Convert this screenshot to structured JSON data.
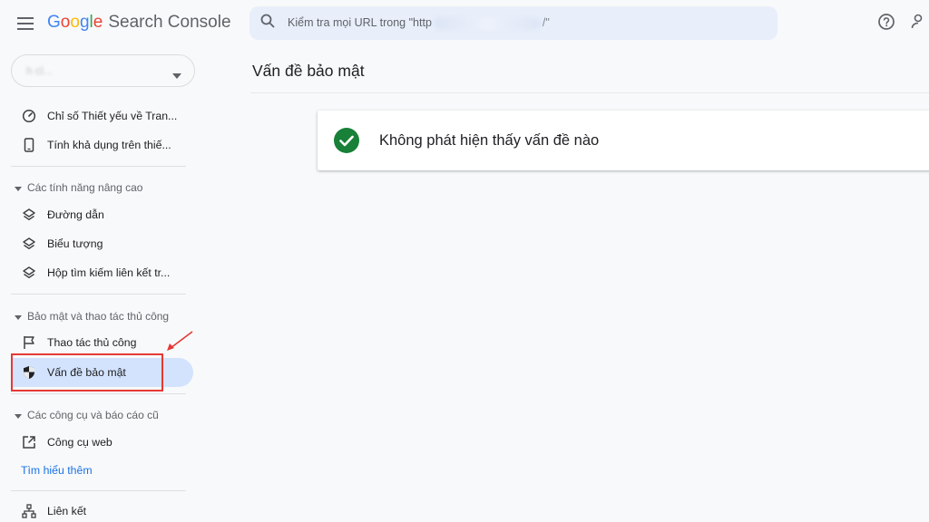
{
  "app": {
    "logo_letters": [
      {
        "char": "G",
        "color": "#4285f4"
      },
      {
        "char": "o",
        "color": "#ea4335"
      },
      {
        "char": "o",
        "color": "#fbbc05"
      },
      {
        "char": "g",
        "color": "#4285f4"
      },
      {
        "char": "l",
        "color": "#34a853"
      },
      {
        "char": "e",
        "color": "#ea4335"
      }
    ],
    "product_name": "Search Console"
  },
  "search": {
    "placeholder_prefix": "Kiểm tra mọi URL trong \"http",
    "placeholder_suffix": "/\""
  },
  "property": {
    "name": "h                cl..."
  },
  "sidebar": {
    "items_top": [
      {
        "label": "Chỉ số Thiết yếu về Tran...",
        "icon": "gauge-icon"
      },
      {
        "label": "Tính khả dụng trên thiế...",
        "icon": "smartphone-icon"
      }
    ],
    "sections": [
      {
        "label": "Các tính năng nâng cao",
        "items": [
          {
            "label": "Đường dẫn",
            "icon": "layers-icon"
          },
          {
            "label": "Biểu tượng",
            "icon": "layers-icon"
          },
          {
            "label": "Hộp tìm kiếm liên kết tr...",
            "icon": "layers-icon"
          }
        ]
      },
      {
        "label": "Bảo mật và thao tác thủ công",
        "items": [
          {
            "label": "Thao tác thủ công",
            "icon": "flag-icon"
          },
          {
            "label": "Vấn đề bảo mật",
            "icon": "shield-icon",
            "active": true
          }
        ]
      },
      {
        "label": "Các công cụ và báo cáo cũ",
        "items": [
          {
            "label": "Công cụ web",
            "icon": "open-external-icon"
          }
        ]
      }
    ],
    "learn_more": "Tìm hiểu thêm",
    "bottom_item": {
      "label": "Liên kết",
      "icon": "sitemap-icon"
    }
  },
  "main": {
    "title": "Vấn đề bảo mật",
    "status_message": "Không phát hiện thấy vấn đề nào",
    "status_color": "#188038"
  },
  "colors": {
    "accent": "#1a73e8",
    "active_bg": "#d3e3fd",
    "annotation": "#e53935"
  }
}
